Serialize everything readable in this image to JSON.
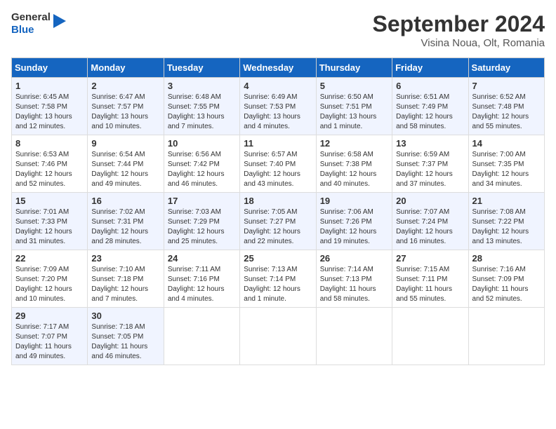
{
  "header": {
    "logo_general": "General",
    "logo_blue": "Blue",
    "title": "September 2024",
    "location": "Visina Noua, Olt, Romania"
  },
  "weekdays": [
    "Sunday",
    "Monday",
    "Tuesday",
    "Wednesday",
    "Thursday",
    "Friday",
    "Saturday"
  ],
  "weeks": [
    [
      {
        "day": "1",
        "info": "Sunrise: 6:45 AM\nSunset: 7:58 PM\nDaylight: 13 hours\nand 12 minutes."
      },
      {
        "day": "2",
        "info": "Sunrise: 6:47 AM\nSunset: 7:57 PM\nDaylight: 13 hours\nand 10 minutes."
      },
      {
        "day": "3",
        "info": "Sunrise: 6:48 AM\nSunset: 7:55 PM\nDaylight: 13 hours\nand 7 minutes."
      },
      {
        "day": "4",
        "info": "Sunrise: 6:49 AM\nSunset: 7:53 PM\nDaylight: 13 hours\nand 4 minutes."
      },
      {
        "day": "5",
        "info": "Sunrise: 6:50 AM\nSunset: 7:51 PM\nDaylight: 13 hours\nand 1 minute."
      },
      {
        "day": "6",
        "info": "Sunrise: 6:51 AM\nSunset: 7:49 PM\nDaylight: 12 hours\nand 58 minutes."
      },
      {
        "day": "7",
        "info": "Sunrise: 6:52 AM\nSunset: 7:48 PM\nDaylight: 12 hours\nand 55 minutes."
      }
    ],
    [
      {
        "day": "8",
        "info": "Sunrise: 6:53 AM\nSunset: 7:46 PM\nDaylight: 12 hours\nand 52 minutes."
      },
      {
        "day": "9",
        "info": "Sunrise: 6:54 AM\nSunset: 7:44 PM\nDaylight: 12 hours\nand 49 minutes."
      },
      {
        "day": "10",
        "info": "Sunrise: 6:56 AM\nSunset: 7:42 PM\nDaylight: 12 hours\nand 46 minutes."
      },
      {
        "day": "11",
        "info": "Sunrise: 6:57 AM\nSunset: 7:40 PM\nDaylight: 12 hours\nand 43 minutes."
      },
      {
        "day": "12",
        "info": "Sunrise: 6:58 AM\nSunset: 7:38 PM\nDaylight: 12 hours\nand 40 minutes."
      },
      {
        "day": "13",
        "info": "Sunrise: 6:59 AM\nSunset: 7:37 PM\nDaylight: 12 hours\nand 37 minutes."
      },
      {
        "day": "14",
        "info": "Sunrise: 7:00 AM\nSunset: 7:35 PM\nDaylight: 12 hours\nand 34 minutes."
      }
    ],
    [
      {
        "day": "15",
        "info": "Sunrise: 7:01 AM\nSunset: 7:33 PM\nDaylight: 12 hours\nand 31 minutes."
      },
      {
        "day": "16",
        "info": "Sunrise: 7:02 AM\nSunset: 7:31 PM\nDaylight: 12 hours\nand 28 minutes."
      },
      {
        "day": "17",
        "info": "Sunrise: 7:03 AM\nSunset: 7:29 PM\nDaylight: 12 hours\nand 25 minutes."
      },
      {
        "day": "18",
        "info": "Sunrise: 7:05 AM\nSunset: 7:27 PM\nDaylight: 12 hours\nand 22 minutes."
      },
      {
        "day": "19",
        "info": "Sunrise: 7:06 AM\nSunset: 7:26 PM\nDaylight: 12 hours\nand 19 minutes."
      },
      {
        "day": "20",
        "info": "Sunrise: 7:07 AM\nSunset: 7:24 PM\nDaylight: 12 hours\nand 16 minutes."
      },
      {
        "day": "21",
        "info": "Sunrise: 7:08 AM\nSunset: 7:22 PM\nDaylight: 12 hours\nand 13 minutes."
      }
    ],
    [
      {
        "day": "22",
        "info": "Sunrise: 7:09 AM\nSunset: 7:20 PM\nDaylight: 12 hours\nand 10 minutes."
      },
      {
        "day": "23",
        "info": "Sunrise: 7:10 AM\nSunset: 7:18 PM\nDaylight: 12 hours\nand 7 minutes."
      },
      {
        "day": "24",
        "info": "Sunrise: 7:11 AM\nSunset: 7:16 PM\nDaylight: 12 hours\nand 4 minutes."
      },
      {
        "day": "25",
        "info": "Sunrise: 7:13 AM\nSunset: 7:14 PM\nDaylight: 12 hours\nand 1 minute."
      },
      {
        "day": "26",
        "info": "Sunrise: 7:14 AM\nSunset: 7:13 PM\nDaylight: 11 hours\nand 58 minutes."
      },
      {
        "day": "27",
        "info": "Sunrise: 7:15 AM\nSunset: 7:11 PM\nDaylight: 11 hours\nand 55 minutes."
      },
      {
        "day": "28",
        "info": "Sunrise: 7:16 AM\nSunset: 7:09 PM\nDaylight: 11 hours\nand 52 minutes."
      }
    ],
    [
      {
        "day": "29",
        "info": "Sunrise: 7:17 AM\nSunset: 7:07 PM\nDaylight: 11 hours\nand 49 minutes."
      },
      {
        "day": "30",
        "info": "Sunrise: 7:18 AM\nSunset: 7:05 PM\nDaylight: 11 hours\nand 46 minutes."
      },
      {
        "day": "",
        "info": ""
      },
      {
        "day": "",
        "info": ""
      },
      {
        "day": "",
        "info": ""
      },
      {
        "day": "",
        "info": ""
      },
      {
        "day": "",
        "info": ""
      }
    ]
  ]
}
